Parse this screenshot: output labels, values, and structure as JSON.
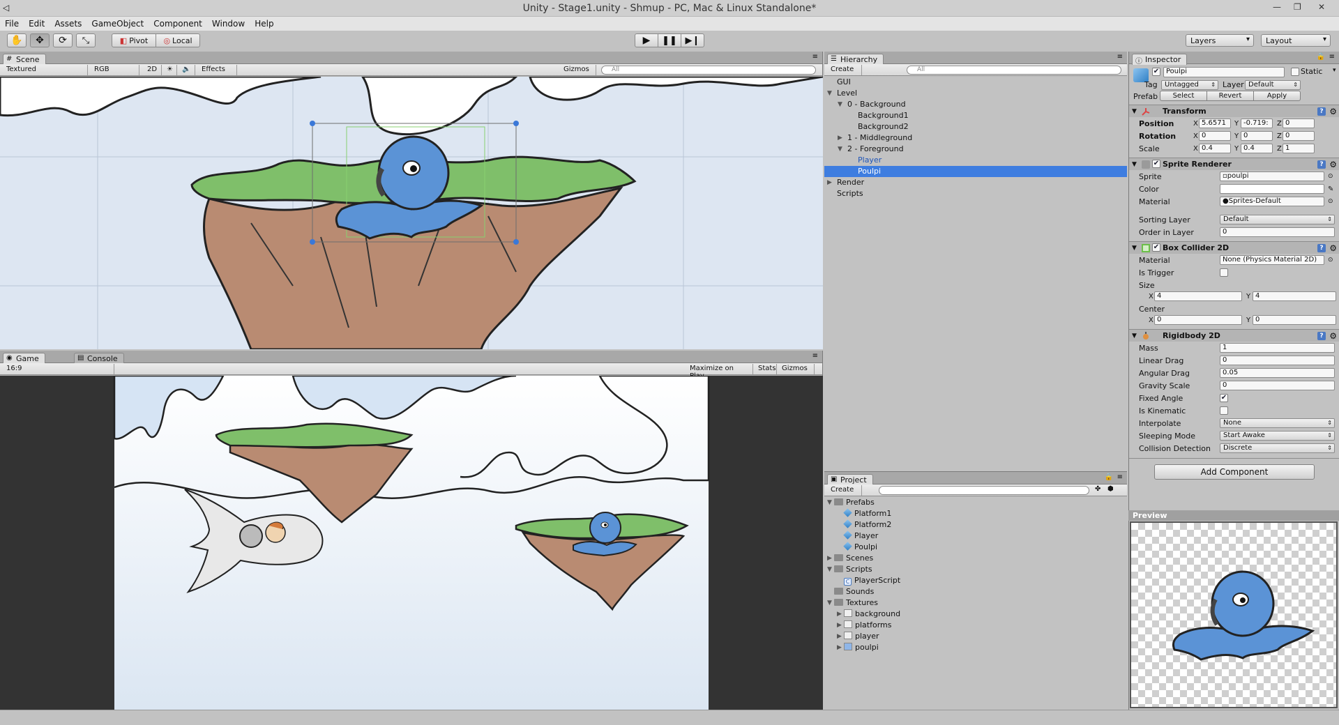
{
  "window": {
    "title": "Unity - Stage1.unity - Shmup - PC, Mac & Linux Standalone*"
  },
  "menu": [
    "File",
    "Edit",
    "Assets",
    "GameObject",
    "Component",
    "Window",
    "Help"
  ],
  "toolbar": {
    "tools": [
      "hand-icon",
      "move-icon",
      "rotate-icon",
      "scale-icon"
    ],
    "active_tool": "move-icon",
    "pivot_label": "Pivot",
    "local_label": "Local",
    "layers_label": "Layers",
    "layout_label": "Layout"
  },
  "scene": {
    "tab": "Scene",
    "shading": "Textured",
    "render_mode": "RGB",
    "mode_2d": "2D",
    "effects": "Effects",
    "gizmos": "Gizmos",
    "search_placeholder": "All"
  },
  "game": {
    "tab": "Game",
    "console_tab": "Console",
    "aspect": "16:9",
    "maximize": "Maximize on Play",
    "stats": "Stats",
    "gizmos": "Gizmos"
  },
  "hierarchy": {
    "tab": "Hierarchy",
    "create": "Create",
    "search_placeholder": "All",
    "items": [
      {
        "label": "GUI"
      },
      {
        "label": "Level"
      },
      {
        "label": "0 - Background"
      },
      {
        "label": "Background1"
      },
      {
        "label": "Background2"
      },
      {
        "label": "1 - Middleground"
      },
      {
        "label": "2 - Foreground"
      },
      {
        "label": "Player"
      },
      {
        "label": "Poulpi"
      },
      {
        "label": "Render"
      },
      {
        "label": "Scripts"
      }
    ]
  },
  "project": {
    "tab": "Project",
    "create": "Create",
    "items": [
      {
        "label": "Prefabs"
      },
      {
        "label": "Platform1"
      },
      {
        "label": "Platform2"
      },
      {
        "label": "Player"
      },
      {
        "label": "Poulpi"
      },
      {
        "label": "Scenes"
      },
      {
        "label": "Scripts"
      },
      {
        "label": "PlayerScript"
      },
      {
        "label": "Sounds"
      },
      {
        "label": "Textures"
      },
      {
        "label": "background"
      },
      {
        "label": "platforms"
      },
      {
        "label": "player"
      },
      {
        "label": "poulpi"
      }
    ]
  },
  "inspector": {
    "tab": "Inspector",
    "object_name": "Poulpi",
    "static_label": "Static",
    "tag_label": "Tag",
    "tag_value": "Untagged",
    "layer_label": "Layer",
    "layer_value": "Default",
    "prefab_label": "Prefab",
    "prefab_select": "Select",
    "prefab_revert": "Revert",
    "prefab_apply": "Apply",
    "transform": {
      "title": "Transform",
      "position_label": "Position",
      "position": {
        "x": "5.6571",
        "y": "-0.719:",
        "z": "0"
      },
      "rotation_label": "Rotation",
      "rotation": {
        "x": "0",
        "y": "0",
        "z": "0"
      },
      "scale_label": "Scale",
      "scale": {
        "x": "0.4",
        "y": "0.4",
        "z": "1"
      }
    },
    "sprite_renderer": {
      "title": "Sprite Renderer",
      "sprite_label": "Sprite",
      "sprite_value": "poulpi",
      "color_label": "Color",
      "material_label": "Material",
      "material_value": "Sprites-Default",
      "sorting_layer_label": "Sorting Layer",
      "sorting_layer_value": "Default",
      "order_label": "Order in Layer",
      "order_value": "0"
    },
    "box_collider": {
      "title": "Box Collider 2D",
      "material_label": "Material",
      "material_value": "None (Physics Material 2D)",
      "trigger_label": "Is Trigger",
      "size_label": "Size",
      "size": {
        "x": "4",
        "y": "4"
      },
      "center_label": "Center",
      "center": {
        "x": "0",
        "y": "0"
      }
    },
    "rigidbody": {
      "title": "Rigidbody 2D",
      "mass_label": "Mass",
      "mass": "1",
      "linear_drag_label": "Linear Drag",
      "linear_drag": "0",
      "angular_drag_label": "Angular Drag",
      "angular_drag": "0.05",
      "gravity_label": "Gravity Scale",
      "gravity": "0",
      "fixed_angle_label": "Fixed Angle",
      "kinematic_label": "Is Kinematic",
      "interpolate_label": "Interpolate",
      "interpolate": "None",
      "sleeping_label": "Sleeping Mode",
      "sleeping": "Start Awake",
      "collision_label": "Collision Detection",
      "collision": "Discrete"
    },
    "add_component": "Add Component",
    "preview_label": "Preview"
  },
  "axis_labels": {
    "x": "X",
    "y": "Y",
    "z": "Z"
  },
  "colors": {
    "selection": "#3e7de0",
    "prefab_text": "#1f55b8",
    "octopus": "#5b93d6",
    "grass": "#7fbf6a",
    "rock": "#b98b72",
    "sky": "#d6e4f4"
  }
}
